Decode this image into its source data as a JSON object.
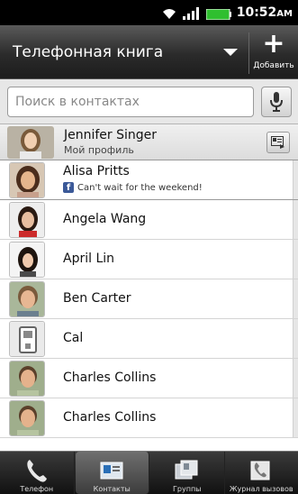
{
  "status_bar": {
    "time": "10:52",
    "ampm": "AM"
  },
  "header": {
    "title": "Телефонная книга",
    "add_label": "Добавить"
  },
  "search": {
    "placeholder": "Поиск в контактах"
  },
  "profile": {
    "name": "Jennifer Singer",
    "subtitle": "Мой профиль"
  },
  "contacts": [
    {
      "name": "Alisa Pritts",
      "status": "Can't wait for the weekend!"
    },
    {
      "name": "Angela Wang"
    },
    {
      "name": "April Lin"
    },
    {
      "name": "Ben Carter"
    },
    {
      "name": "Cal"
    },
    {
      "name": "Charles Collins"
    },
    {
      "name": "Charles Collins"
    }
  ],
  "tabs": [
    {
      "label": "Телефон",
      "icon": "phone-icon"
    },
    {
      "label": "Контакты",
      "icon": "contacts-icon",
      "active": true
    },
    {
      "label": "Группы",
      "icon": "groups-icon"
    },
    {
      "label": "Журнал вызовов",
      "icon": "call-log-icon"
    }
  ],
  "colors": {
    "facebook": "#3b5998"
  }
}
